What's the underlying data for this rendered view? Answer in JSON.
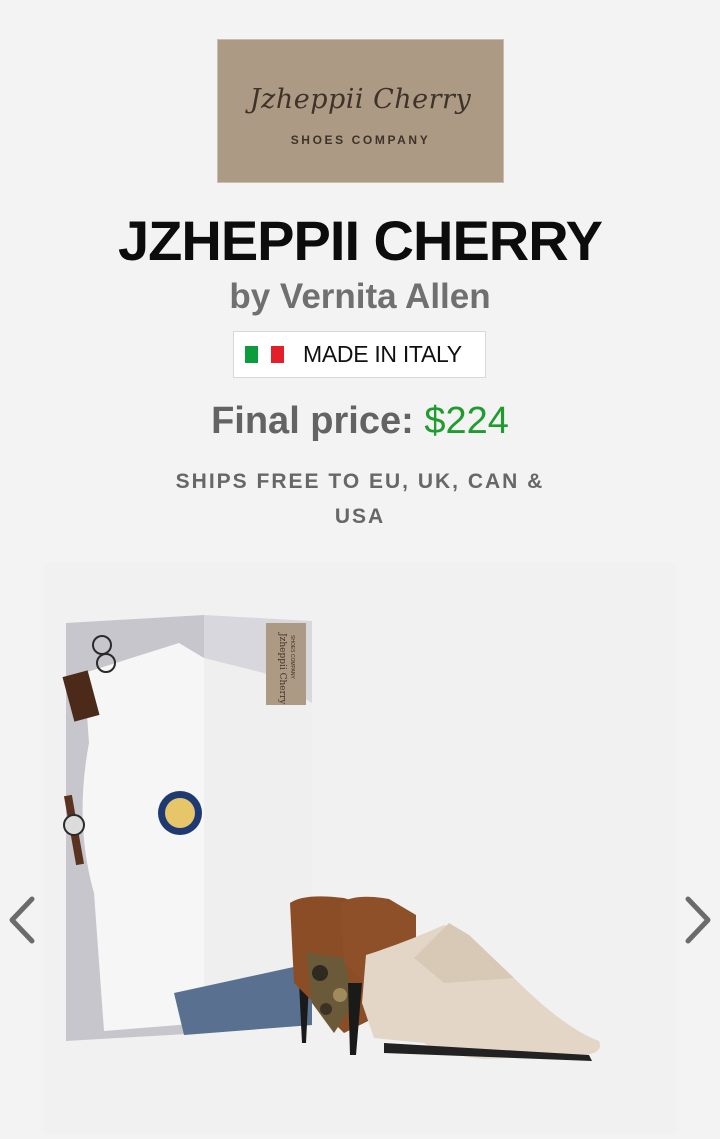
{
  "logo": {
    "script_text": "Jzheppii Cherry",
    "sub_text": "SHOES COMPANY",
    "background": "#ad9a84"
  },
  "product": {
    "title": "JZHEPPII CHERRY",
    "byline": "by Vernita Allen"
  },
  "badge": {
    "text": "MADE IN ITALY",
    "flag_colors": [
      "#0c9c3c",
      "#ffffff",
      "#e3202a"
    ]
  },
  "price": {
    "label": "Final price:",
    "value": "$224",
    "value_color": "#1f9c2e"
  },
  "shipping": {
    "text": "SHIPS FREE TO EU, UK, CAN & USA"
  },
  "carousel": {
    "prev_icon": "chevron-left-icon",
    "next_icon": "chevron-right-icon",
    "box_label_script": "Jzheppii Cherry",
    "box_label_sub": "SHOES COMPANY"
  }
}
